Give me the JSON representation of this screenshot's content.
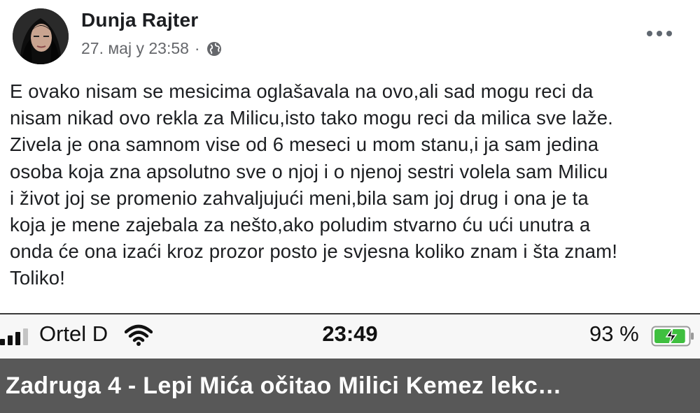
{
  "post": {
    "author": "Dunja Rajter",
    "timestamp": "27. мај у 23:58",
    "separator": "·",
    "privacy_icon": "globe-icon",
    "more_icon": "more-options-icon",
    "text": "E ovako nisam se mesicima oglašavala na ovo,ali sad mogu reci da\nnisam nikad ovo rekla za Milicu,isto tako mogu reci da milica sve laže.\nZivela je ona samnom vise od 6 meseci u mom stanu,i ja sam jedina\nosoba koja zna apsolutno sve o njoj i o njenoj sestri volela sam Milicu\ni život joj se promenio zahvaljujući meni,bila sam joj drug i ona je ta\nkoja je mene zajebala za nešto,ako poludim stvarno ću ući unutra a\nonda će ona izaći kroz prozor posto je svjesna koliko znam i šta znam!\nToliko!"
  },
  "statusbar": {
    "carrier": "Ortel D",
    "time": "23:49",
    "battery": "93 %",
    "battery_level": 0.93,
    "signal_bars_active": 3,
    "signal_bars_total": 4,
    "colors": {
      "battery": "#3fbf3f"
    }
  },
  "caption": {
    "text": "Zadruga 4 - Lepi Mića očitao Milici Kemez lekc…"
  }
}
